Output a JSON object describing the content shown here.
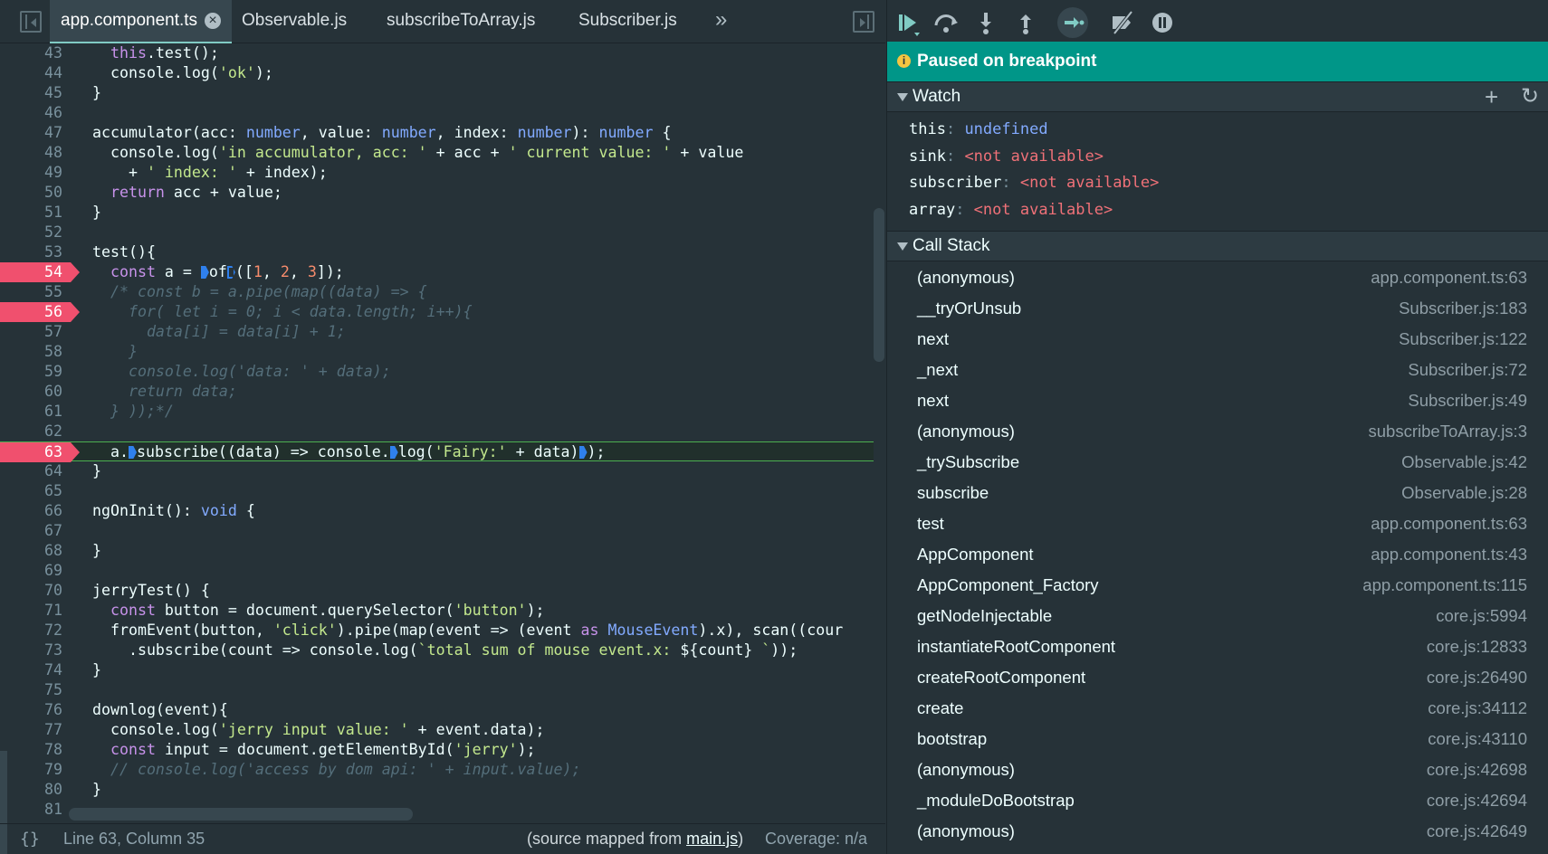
{
  "tabs": [
    {
      "label": "app.component.ts",
      "active": true
    },
    {
      "label": "Observable.js"
    },
    {
      "label": "subscribeToArray.js"
    },
    {
      "label": "Subscriber.js"
    }
  ],
  "tab_overflow": "»",
  "code_lines": [
    {
      "n": "43",
      "html": "  <span class=\"kw\">this</span>.test();"
    },
    {
      "n": "44",
      "html": "  console.log(<span class=\"st\">'ok'</span>);"
    },
    {
      "n": "45",
      "html": "}"
    },
    {
      "n": "46",
      "html": ""
    },
    {
      "n": "47",
      "html": "accumulator(acc: <span class=\"ty\">number</span>, value: <span class=\"ty\">number</span>, index: <span class=\"ty\">number</span>): <span class=\"ty\">number</span> {"
    },
    {
      "n": "48",
      "html": "  console.log(<span class=\"st\">'in accumulator, acc: '</span> + acc + <span class=\"st\">' current value: '</span> + value"
    },
    {
      "n": "49",
      "html": "    + <span class=\"st\">' index: '</span> + index);"
    },
    {
      "n": "50",
      "html": "  <span class=\"kw\">return</span> acc + value;"
    },
    {
      "n": "51",
      "html": "}"
    },
    {
      "n": "52",
      "html": ""
    },
    {
      "n": "53",
      "html": "test(){"
    },
    {
      "n": "54",
      "bp": true,
      "html": "  <span class=\"kw\">const</span> a = <span class=\"tag\"></span>of<span class=\"tag hollow\"></span>([<span class=\"nm\">1</span>, <span class=\"nm\">2</span>, <span class=\"nm\">3</span>]);"
    },
    {
      "n": "55",
      "html": "  <span class=\"cm\">/* const b = a.pipe(map((data) => {</span>"
    },
    {
      "n": "56",
      "bp": true,
      "html": "<span class=\"cm\">    for( let i = 0; i &lt; data.length; i++){</span>"
    },
    {
      "n": "57",
      "html": "<span class=\"cm\">      data[i] = data[i] + 1;</span>"
    },
    {
      "n": "58",
      "html": "<span class=\"cm\">    }</span>"
    },
    {
      "n": "59",
      "html": "<span class=\"cm\">    console.log('data: ' + data);</span>"
    },
    {
      "n": "60",
      "html": "<span class=\"cm\">    return data;</span>"
    },
    {
      "n": "61",
      "html": "<span class=\"cm\">  } ));*/</span>"
    },
    {
      "n": "62",
      "html": ""
    },
    {
      "n": "63",
      "bp": true,
      "current": true,
      "html": "  a.<span class=\"tag\"></span>subscribe((data) => console.<span class=\"tag\"></span>log(<span class=\"st\">'Fairy:'</span> + data)<span class=\"tag\"></span>);"
    },
    {
      "n": "64",
      "html": "}"
    },
    {
      "n": "65",
      "html": ""
    },
    {
      "n": "66",
      "html": "ngOnInit(): <span class=\"ty\">void</span> {"
    },
    {
      "n": "67",
      "html": ""
    },
    {
      "n": "68",
      "html": "}"
    },
    {
      "n": "69",
      "html": ""
    },
    {
      "n": "70",
      "html": "jerryTest() {"
    },
    {
      "n": "71",
      "html": "  <span class=\"kw\">const</span> button = document.querySelector(<span class=\"st\">'button'</span>);"
    },
    {
      "n": "72",
      "html": "  fromEvent(button, <span class=\"st\">'click'</span>).pipe(map(event => (event <span class=\"kw\">as</span> <span class=\"ty\">MouseEvent</span>).x), scan((cour"
    },
    {
      "n": "73",
      "html": "    .subscribe(count => console.log(<span class=\"st\">`total sum of mouse event.x: </span>${count}<span class=\"st\"> `</span>));"
    },
    {
      "n": "74",
      "html": "}"
    },
    {
      "n": "75",
      "html": ""
    },
    {
      "n": "76",
      "html": "downlog(event){"
    },
    {
      "n": "77",
      "html": "  console.log(<span class=\"st\">'jerry input value: '</span> + event.data);"
    },
    {
      "n": "78",
      "html": "  <span class=\"kw\">const</span> input = document.getElementById(<span class=\"st\">'jerry'</span>);"
    },
    {
      "n": "79",
      "html": "  <span class=\"cm\">// console.log('access by dom api: ' + input.value);</span>"
    },
    {
      "n": "80",
      "html": "}"
    },
    {
      "n": "81",
      "html": ""
    }
  ],
  "status": {
    "braces": "{}",
    "cursor": "Line 63, Column 35",
    "source_prefix": "(source mapped from ",
    "source_file": "main.js",
    "source_suffix": ")",
    "coverage": "Coverage: n/a"
  },
  "debugger": {
    "paused_text": "Paused on breakpoint",
    "watch_title": "Watch",
    "watch": [
      {
        "name": "this",
        "value": "undefined",
        "na": false
      },
      {
        "name": "sink",
        "value": "<not available>",
        "na": true
      },
      {
        "name": "subscriber",
        "value": "<not available>",
        "na": true
      },
      {
        "name": "array",
        "value": "<not available>",
        "na": true
      }
    ],
    "callstack_title": "Call Stack",
    "callstack": [
      {
        "fn": "(anonymous)",
        "loc": "app.component.ts:63"
      },
      {
        "fn": "__tryOrUnsub",
        "loc": "Subscriber.js:183"
      },
      {
        "fn": "next",
        "loc": "Subscriber.js:122"
      },
      {
        "fn": "_next",
        "loc": "Subscriber.js:72"
      },
      {
        "fn": "next",
        "loc": "Subscriber.js:49"
      },
      {
        "fn": "(anonymous)",
        "loc": "subscribeToArray.js:3"
      },
      {
        "fn": "_trySubscribe",
        "loc": "Observable.js:42"
      },
      {
        "fn": "subscribe",
        "loc": "Observable.js:28"
      },
      {
        "fn": "test",
        "loc": "app.component.ts:63"
      },
      {
        "fn": "AppComponent",
        "loc": "app.component.ts:43"
      },
      {
        "fn": "AppComponent_Factory",
        "loc": "app.component.ts:115"
      },
      {
        "fn": "getNodeInjectable",
        "loc": "core.js:5994"
      },
      {
        "fn": "instantiateRootComponent",
        "loc": "core.js:12833"
      },
      {
        "fn": "createRootComponent",
        "loc": "core.js:26490"
      },
      {
        "fn": "create",
        "loc": "core.js:34112"
      },
      {
        "fn": "bootstrap",
        "loc": "core.js:43110"
      },
      {
        "fn": "(anonymous)",
        "loc": "core.js:42698"
      },
      {
        "fn": "_moduleDoBootstrap",
        "loc": "core.js:42694"
      },
      {
        "fn": "(anonymous)",
        "loc": "core.js:42649"
      }
    ]
  },
  "icons": {
    "resume": "resume-icon",
    "step_over": "step-over-icon",
    "step_into": "step-into-icon",
    "step_out": "step-out-icon",
    "step": "step-icon",
    "deactivate": "deactivate-breakpoints-icon",
    "pause_exceptions": "pause-on-exceptions-icon"
  }
}
